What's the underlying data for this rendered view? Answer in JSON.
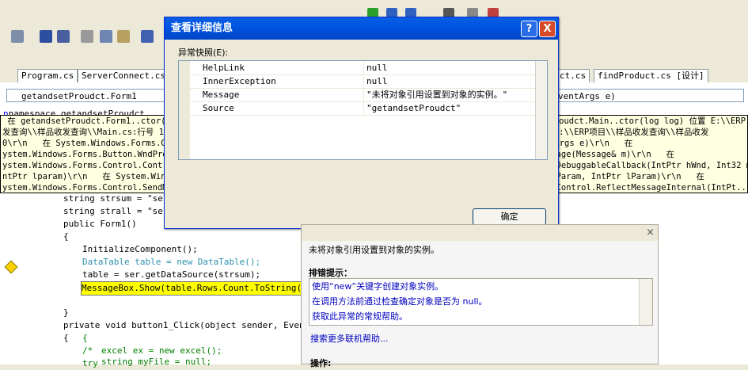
{
  "colors": {
    "accent": "#0054e3",
    "tooltip_bg": "#ffffe1",
    "link": "#0000c0"
  },
  "tabs": [
    "Program.cs",
    "ServerConnect.cs",
    "ct.cs",
    "findProduct.cs [设计]"
  ],
  "nav": {
    "left": "getandsetProudct.Form1",
    "right": "ventArgs e)"
  },
  "code": {
    "ns": "namespace getandsetProudct",
    "l1": "string strsum = \"sele",
    "l2": "string strall = \"sele",
    "l3": "public Form1()",
    "l4": "{",
    "l5": "InitializeComponent();",
    "l6": "DataTable table = new DataTable();",
    "l7": "table = ser.getDataSource(strsum);",
    "l8": "MessageBox.Show(table.Rows.Count.ToString());",
    "l9": "}",
    "l10": "private void button1_Click(object sender, EventArg",
    "l11": "{",
    "l12": "/*",
    "l13": "try",
    "l14": "{",
    "l15": "excel ex = new excel();",
    "l16": "string myFile = null;"
  },
  "tooltip": {
    "lines": [
      " 在 getandsetProudct.Form1..ctor() 位置 E:\\\\ERP项目\\\\样品收发查询\\\\样品收发查询\\\\Form1.cs:行号 30\\r\\n   在 getandsetProudct.Main..ctor(log log) 位置 E:\\\\ERP",
      "发查询\\\\样品收发查询\\\\Main.cs:行号 18\\r\\n   在 getandsetProudct.log.button1_Click(Object sender, EventArgs e) 位置 E:\\\\ERP项目\\\\样品收发查询\\\\样品收发",
      "0\\r\\n   在 System.Windows.Forms.Control.OnClick(EventArgs e)\\r\\n   在 System.Windows.Forms.Button.OnClick(EventArgs e)\\r\\n   在",
      "ystem.Windows.Forms.Button.WndProc(Message& m)\\r\\n   在 System.Windows.Forms.Control.ControlNativeWindow.OnMessage(Message& m)\\r\\n   在",
      "ystem.Windows.Forms.Control.ControlNativeWindow.WndProc(Message& m)\\r\\n   在 System.Windows.Forms.NativeWindow.DebuggableCallback(IntPtr hWnd, Int32 msg, In",
      "ntPtr lparam)\\r\\n   在 System.Windows.Forms.UnsafeNativeMethods.SendMessage(HandleRef hWnd, Int32 msg, IntPtr wParam, IntPtr lParam)\\r\\n   在",
      "ystem.Windows.Forms.Control.SendMessage(Int32 msg, IntPtr wparam, IntPtr lparam)\\r\\n   在 System.Windows.Forms.Control.ReflectMessageInternal(IntPt..."
    ]
  },
  "dialog": {
    "title": "查看详细信息",
    "help": "?",
    "close": "X",
    "section": "异常快照(E):",
    "rows": [
      {
        "k": "HelpLink",
        "v": "null"
      },
      {
        "k": "InnerException",
        "v": "null"
      },
      {
        "k": "Message",
        "v": "\"未将对象引用设置到对象的实例。\""
      },
      {
        "k": "Source",
        "v": "\"getandsetProudct\""
      }
    ],
    "ok": "确定"
  },
  "assistant": {
    "message": "未将对象引用设置到对象的实例。",
    "hints_title": "排错提示：",
    "hints": [
      "使用“new”关键字创建对象实例。",
      "在调用方法前通过检查确定对象是否为 null。",
      "获取此异常的常规帮助。"
    ],
    "more": "搜索更多联机帮助...",
    "actions": "操作:",
    "close": "×"
  }
}
